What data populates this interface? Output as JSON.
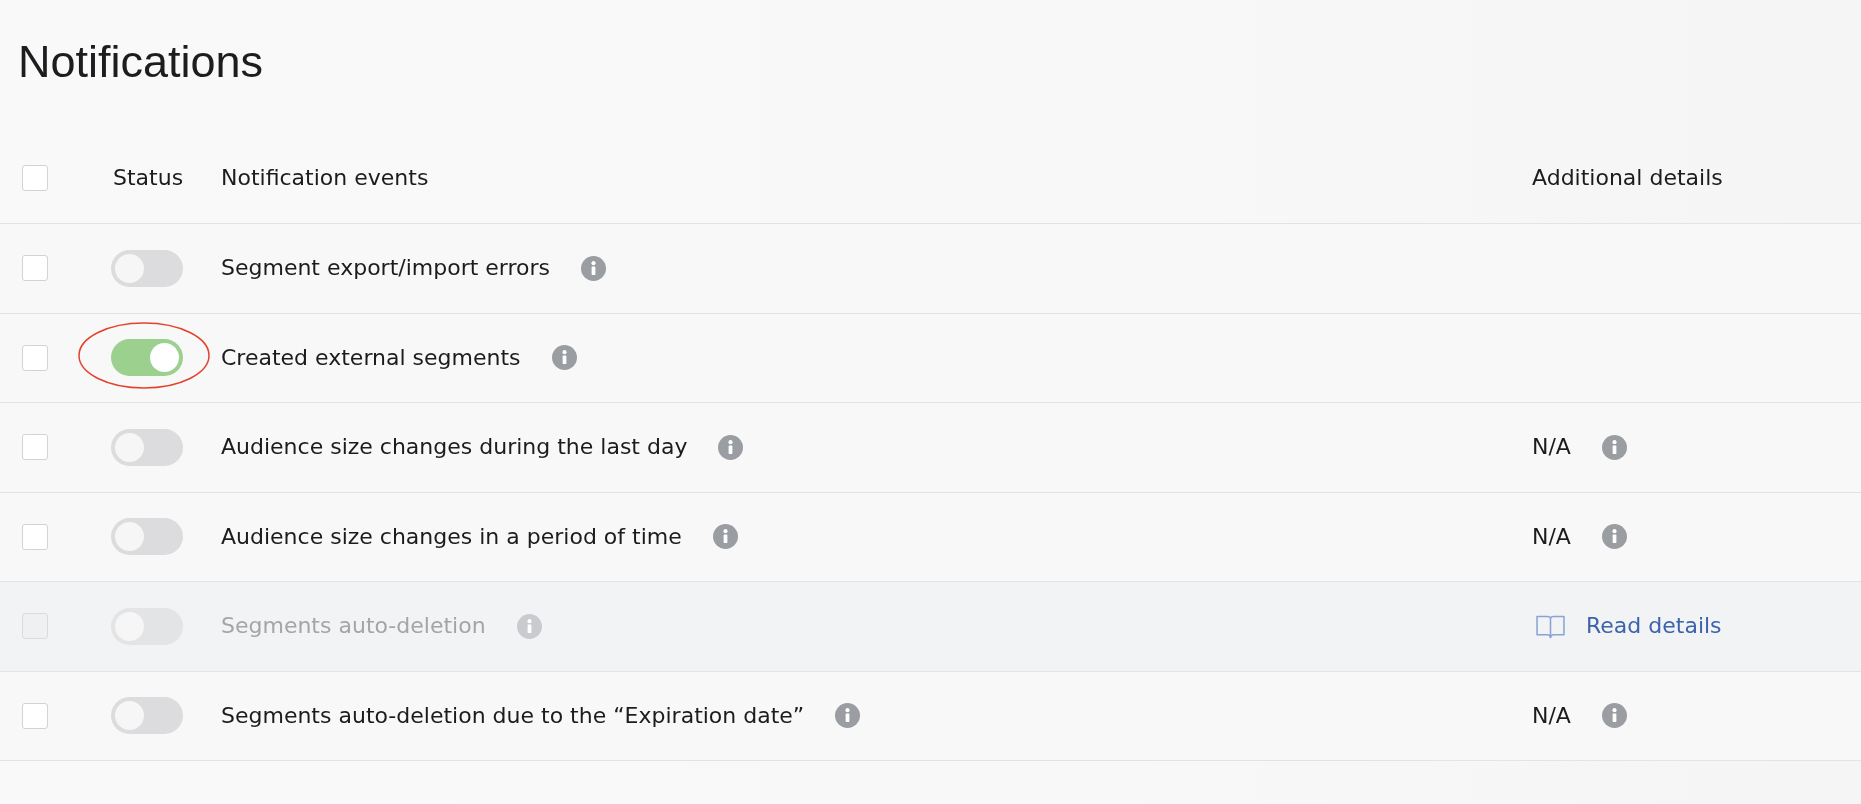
{
  "page": {
    "title": "Notifications"
  },
  "table": {
    "select_all": {
      "checked": false
    },
    "columns": [
      "Status",
      "Notification events",
      "Additional details"
    ],
    "rows": [
      {
        "checked": false,
        "on": false,
        "disabled": false,
        "highlighted": false,
        "event": "Segment export/import errors"
      },
      {
        "checked": false,
        "on": true,
        "disabled": false,
        "highlighted": true,
        "event": "Created external segments"
      },
      {
        "checked": false,
        "on": false,
        "disabled": false,
        "highlighted": false,
        "event": "Audience size changes during the last day",
        "details": {
          "kind": "text",
          "text": "N/A"
        }
      },
      {
        "checked": false,
        "on": false,
        "disabled": false,
        "highlighted": false,
        "event": "Audience size changes in a period of time",
        "details": {
          "kind": "text",
          "text": "N/A"
        }
      },
      {
        "checked": false,
        "on": false,
        "disabled": true,
        "highlighted": false,
        "event": "Segments auto-deletion",
        "details": {
          "kind": "link",
          "text": "Read details"
        }
      },
      {
        "checked": false,
        "on": false,
        "disabled": false,
        "highlighted": false,
        "event": "Segments auto-deletion due to the “Expiration date”",
        "details": {
          "kind": "text",
          "text": "N/A"
        }
      }
    ]
  }
}
